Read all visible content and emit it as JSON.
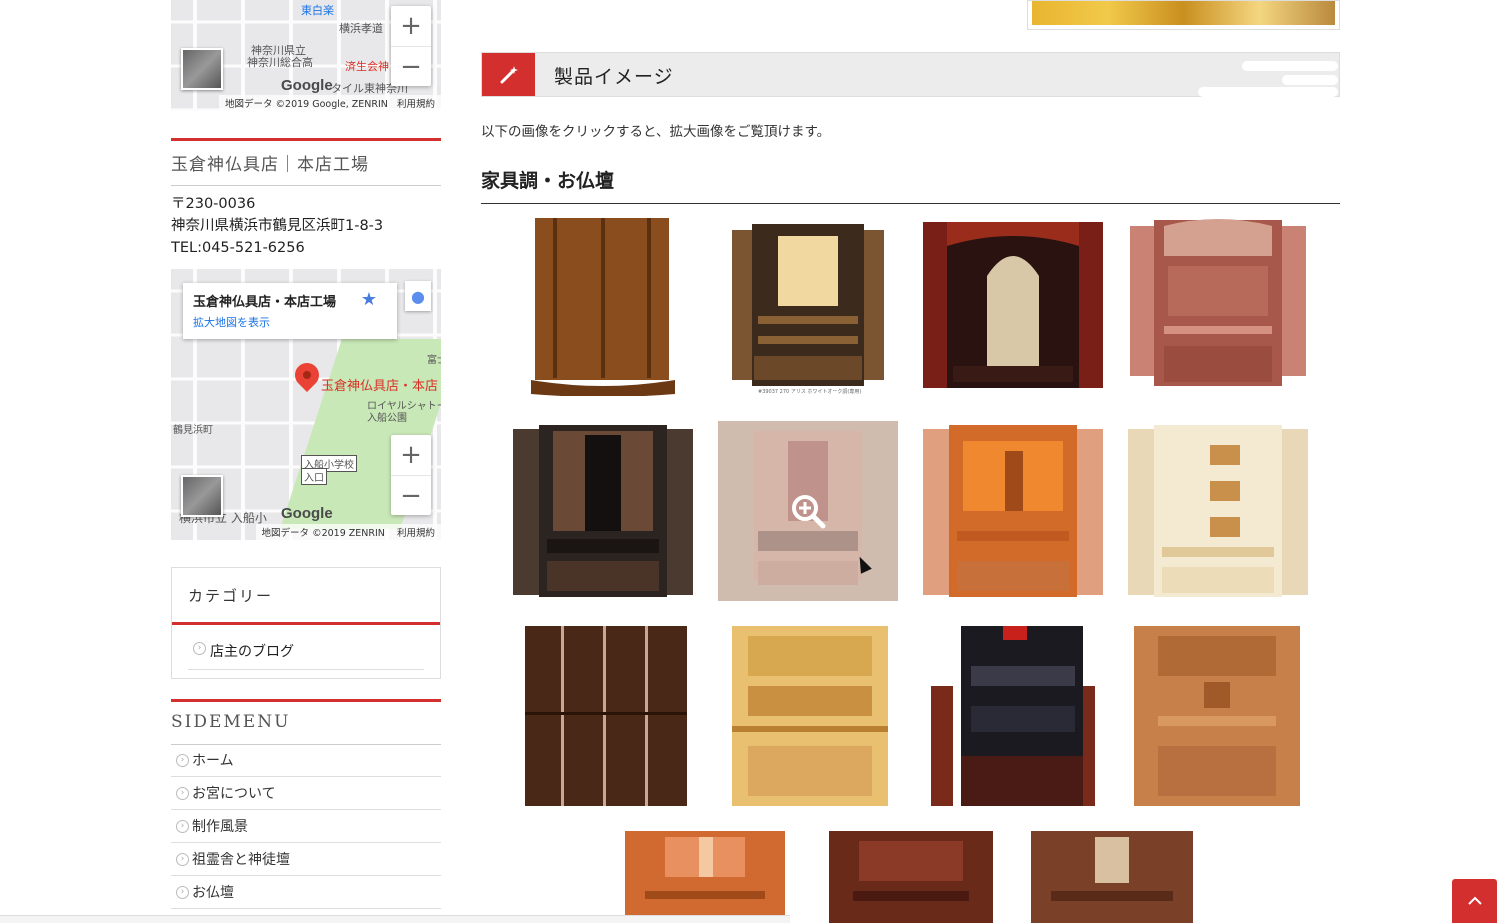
{
  "map_top": {
    "labels": [
      "東白楽",
      "横浜孝道",
      "神奈川県立",
      "神奈川総合高",
      "済生会神",
      "タイル東神奈川"
    ],
    "attribution": "地図データ ©2019 Google, ZENRIN",
    "terms": "利用規約",
    "google": "Google",
    "zoom_in": "+",
    "zoom_out": "−"
  },
  "shop": {
    "title": "玉倉神仏具店｜本店工場",
    "postal": "〒230-0036",
    "address": "神奈川県横浜市鶴見区浜町1-8-3",
    "tel": "TEL:045-521-6256"
  },
  "map_bottom": {
    "card_title": "玉倉神仏具店・本店工場",
    "card_link": "拡大地図を表示",
    "pin_label": "玉倉神仏具店・本店",
    "labels": [
      "ロイヤルシャトー",
      "入船公園",
      "鶴見浜町",
      "入船小学校",
      "入口",
      "横浜市立 入船小",
      "富士"
    ],
    "attribution": "地図データ ©2019 ZENRIN",
    "terms": "利用規約",
    "google": "Google",
    "zoom_in": "+",
    "zoom_out": "−"
  },
  "category": {
    "title": "カテゴリー",
    "items": [
      "店主のブログ"
    ]
  },
  "sidemenu": {
    "title": "SIDEMENU",
    "items": [
      "ホーム",
      "お宮について",
      "制作風景",
      "祖霊舎と神徒壇",
      "お仏壇"
    ]
  },
  "main": {
    "section_title": "製品イメージ",
    "intro": "以下の画像をクリックすると、拡大画像をご覧頂けます。",
    "category_heading": "家具調・お仏壇",
    "thumb2_caption": "#39037 270 アリス ホワイトオーク調(専用)"
  },
  "colors": {
    "accent": "#d32f2f"
  },
  "icons": {
    "section": "magic-wand-icon",
    "zoom": "zoom-in-icon",
    "back_to_top": "chevron-up-icon"
  }
}
